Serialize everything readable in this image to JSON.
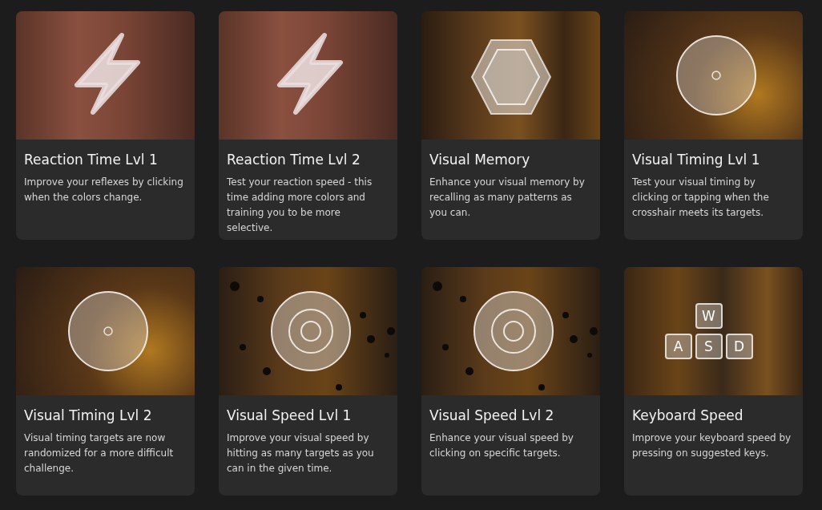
{
  "cards": [
    {
      "kind": "bolt",
      "title": "Reaction Time Lvl 1",
      "description": "Improve your reflexes by clicking when the colors change."
    },
    {
      "kind": "bolt",
      "title": "Reaction Time Lvl 2",
      "description": "Test your reaction speed - this time adding more colors and training you to be more selective."
    },
    {
      "kind": "hexagon",
      "title": "Visual Memory",
      "description": "Enhance your visual memory by recalling as many patterns as you can."
    },
    {
      "kind": "dial",
      "title": "Visual Timing Lvl 1",
      "description": "Test your visual timing by clicking or tapping when the crosshair meets its targets."
    },
    {
      "kind": "dial",
      "title": "Visual Timing Lvl 2",
      "description": "Visual timing targets are now randomized for a more difficult challenge."
    },
    {
      "kind": "target",
      "title": "Visual Speed Lvl 1",
      "description": "Improve your visual speed by hitting as many targets as you can in the given time."
    },
    {
      "kind": "target",
      "title": "Visual Speed Lvl 2",
      "description": "Enhance your visual speed by clicking on specific targets."
    },
    {
      "kind": "keys",
      "title": "Keyboard Speed",
      "description": "Improve your keyboard speed by pressing on suggested keys.",
      "keys": [
        "W",
        "A",
        "S",
        "D"
      ]
    }
  ]
}
